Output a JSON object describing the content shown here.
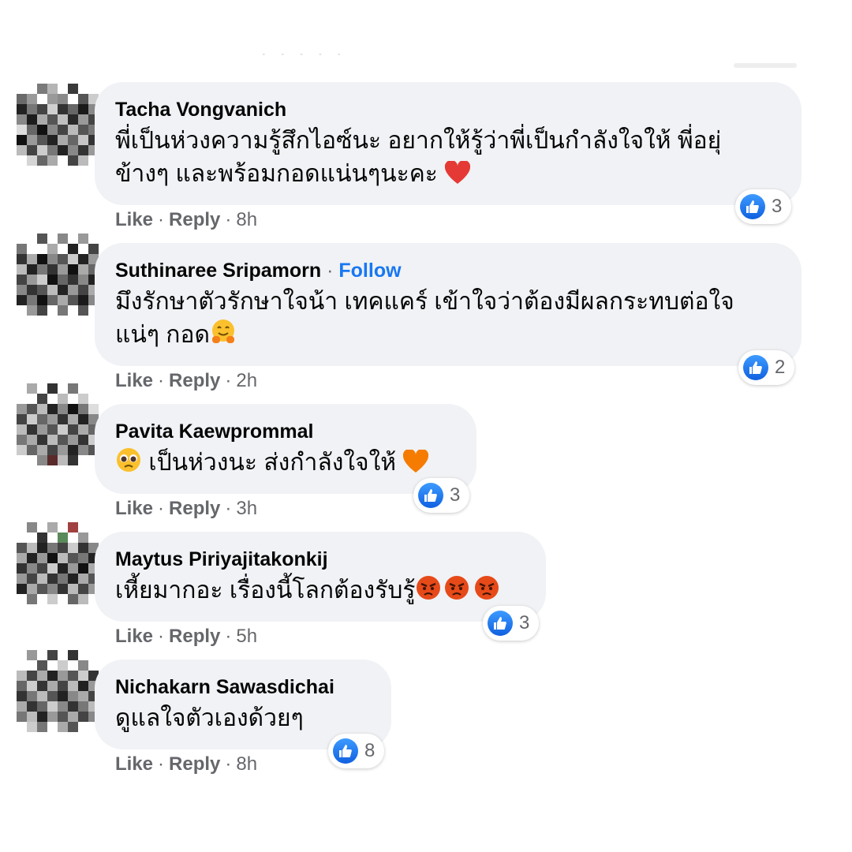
{
  "comments": [
    {
      "author": "Tacha Vongvanich",
      "text": "พี่เป็นห่วงความรู้สึกไอซ์นะ อยากให้รู้ว่าพี่เป็นกำลังใจให้ พี่อยุ่\nข้างๆ และพร้อมกอดแน่นๆนะคะ",
      "trailing_emoji": "red-heart-emoji",
      "reaction_icon": "like-icon",
      "reaction_count": "3",
      "like_label": "Like",
      "reply_label": "Reply",
      "time": "8h"
    },
    {
      "author": "Suthinaree Sripamorn",
      "follow_label": "Follow",
      "text": "มึงรักษาตัวรักษาใจน้า เทคแคร์ เข้าใจว่าต้องมีผลกระทบต่อใจ\nแน่ๆ กอด",
      "trailing_emoji": "hugging-face-emoji",
      "reaction_icon": "like-icon",
      "reaction_count": "2",
      "like_label": "Like",
      "reply_label": "Reply",
      "time": "2h"
    },
    {
      "author": "Pavita Kaewprommal",
      "leading_emoji": "pleading-face-emoji",
      "text": "เป็นห่วงนะ ส่งกำลังใจให้",
      "trailing_emoji": "orange-heart-emoji",
      "reaction_icon": "like-icon",
      "reaction_count": "3",
      "like_label": "Like",
      "reply_label": "Reply",
      "time": "3h"
    },
    {
      "author": "Maytus Piriyajitakonkij",
      "text": "เหี้ยมากอะ เรื่องนี้โลกต้องรับรู้",
      "trailing_emoji": "angry-face-emoji x3",
      "reaction_icon": "like-icon",
      "reaction_count": "3",
      "like_label": "Like",
      "reply_label": "Reply",
      "time": "5h"
    },
    {
      "author": "Nichakarn Sawasdichai",
      "text": "ดูแลใจตัวเองด้วยๆ",
      "reaction_icon": "like-icon",
      "reaction_count": "8",
      "like_label": "Like",
      "reply_label": "Reply",
      "time": "8h"
    }
  ],
  "colors": {
    "bubble": "#f0f2f5",
    "author": "#050505",
    "meta": "#65676b",
    "follow": "#1877f2",
    "like_badge": "#1877f2"
  }
}
